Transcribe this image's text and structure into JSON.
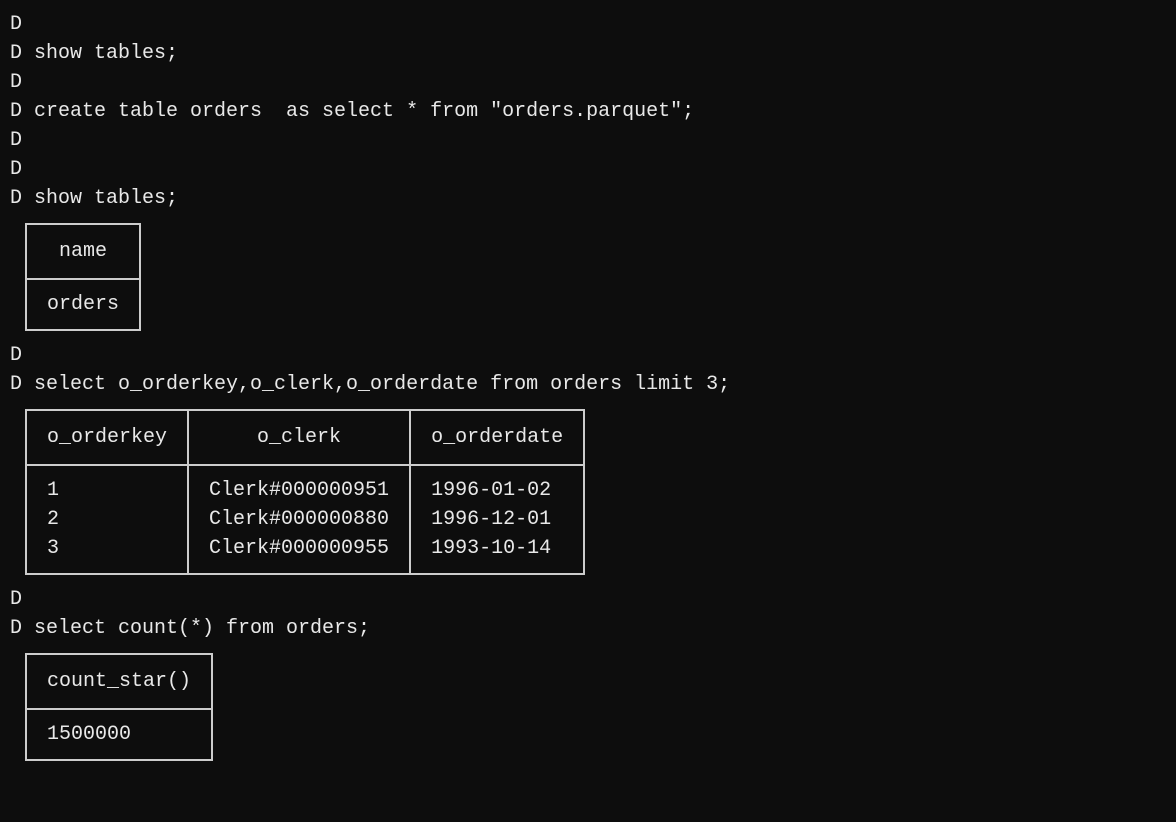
{
  "prompt_char": "D",
  "lines": [
    {
      "type": "prompt",
      "text": ""
    },
    {
      "type": "prompt",
      "text": "show tables;"
    },
    {
      "type": "prompt",
      "text": ""
    },
    {
      "type": "prompt",
      "text": "create table orders  as select * from \"orders.parquet\";"
    },
    {
      "type": "prompt",
      "text": ""
    },
    {
      "type": "prompt",
      "text": ""
    },
    {
      "type": "prompt",
      "text": "show tables;"
    }
  ],
  "table1": {
    "headers": [
      "name"
    ],
    "rows": [
      [
        "orders"
      ]
    ]
  },
  "lines2": [
    {
      "type": "prompt",
      "text": ""
    },
    {
      "type": "prompt",
      "text": "select o_orderkey,o_clerk,o_orderdate from orders limit 3;"
    }
  ],
  "table2": {
    "headers": [
      "o_orderkey",
      "o_clerk",
      "o_orderdate"
    ],
    "rows": [
      [
        "1",
        "Clerk#000000951",
        "1996-01-02"
      ],
      [
        "2",
        "Clerk#000000880",
        "1996-12-01"
      ],
      [
        "3",
        "Clerk#000000955",
        "1993-10-14"
      ]
    ]
  },
  "lines3": [
    {
      "type": "prompt",
      "text": ""
    },
    {
      "type": "prompt",
      "text": "select count(*) from orders;"
    }
  ],
  "table3": {
    "headers": [
      "count_star()"
    ],
    "rows": [
      [
        "1500000"
      ]
    ]
  }
}
